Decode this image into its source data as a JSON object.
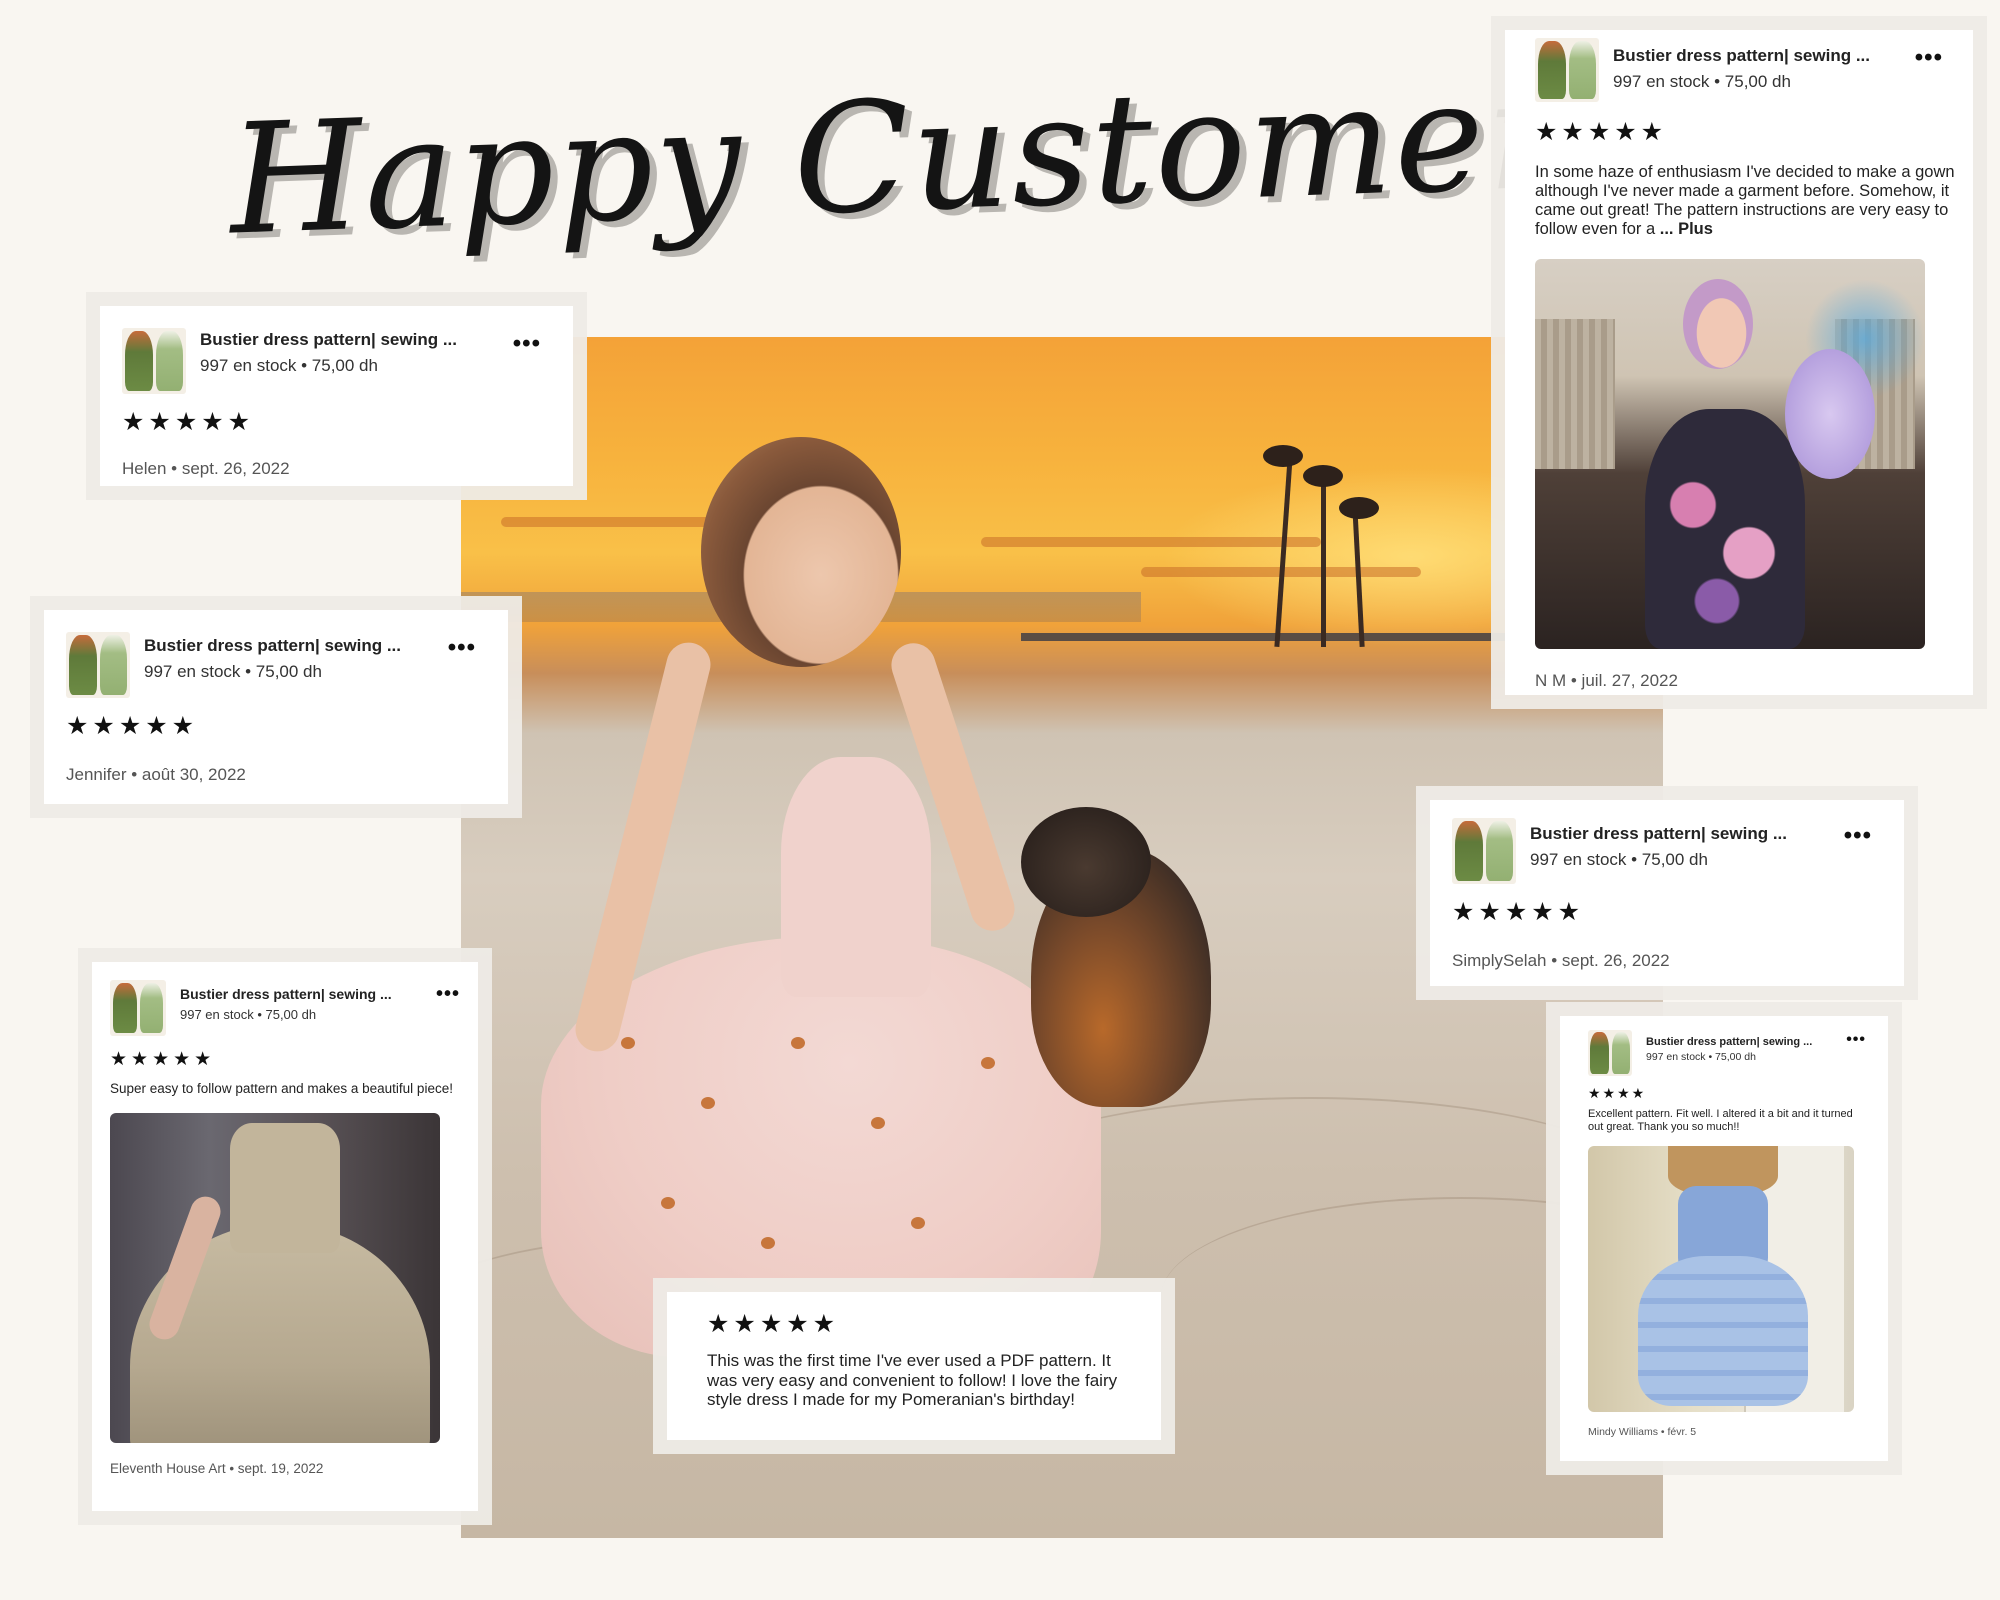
{
  "headline": "Happy Customers",
  "common": {
    "product_title": "Bustier dress pattern| sewing ...",
    "stock_price": "997 en stock • 75,00 dh",
    "menu_glyph": "•••",
    "stars": "★★★★★"
  },
  "reviews": [
    {
      "id": "helen",
      "byline": "Helen • sept. 26, 2022"
    },
    {
      "id": "jennifer",
      "byline": "Jennifer • août 30, 2022"
    },
    {
      "id": "nm",
      "text": "In some haze of enthusiasm I've decided to make a gown although I've never made a garment before. Somehow, it came out great! The pattern instructions are very easy to follow even for a",
      "more": "... Plus",
      "byline": "N M • juil. 27, 2022"
    },
    {
      "id": "simplyselah",
      "byline": "SimplySelah • sept. 26, 2022"
    },
    {
      "id": "eleventh",
      "text": "Super easy to follow pattern and makes a beautiful piece!",
      "byline": "Eleventh House Art • sept. 19, 2022"
    },
    {
      "id": "mindy",
      "stars": "★★★★",
      "text": "Excellent pattern.  Fit well.  I altered it a bit and it turned out great.  Thank you so much!!",
      "byline": "Mindy Williams • févr. 5"
    },
    {
      "id": "pomeranian",
      "text": "This was the first time I've ever used a PDF pattern. It was very easy and convenient to follow! I love the fairy style dress I made for my Pomeranian's birthday!"
    }
  ],
  "colors": {
    "background": "#f9f6f1",
    "card": "#ffffff",
    "text": "#222222",
    "sunset": "#f7b23d",
    "sand": "#d8cdbf"
  },
  "icons": {
    "menu": "more-horizontal-icon",
    "rating": "star-icon"
  }
}
